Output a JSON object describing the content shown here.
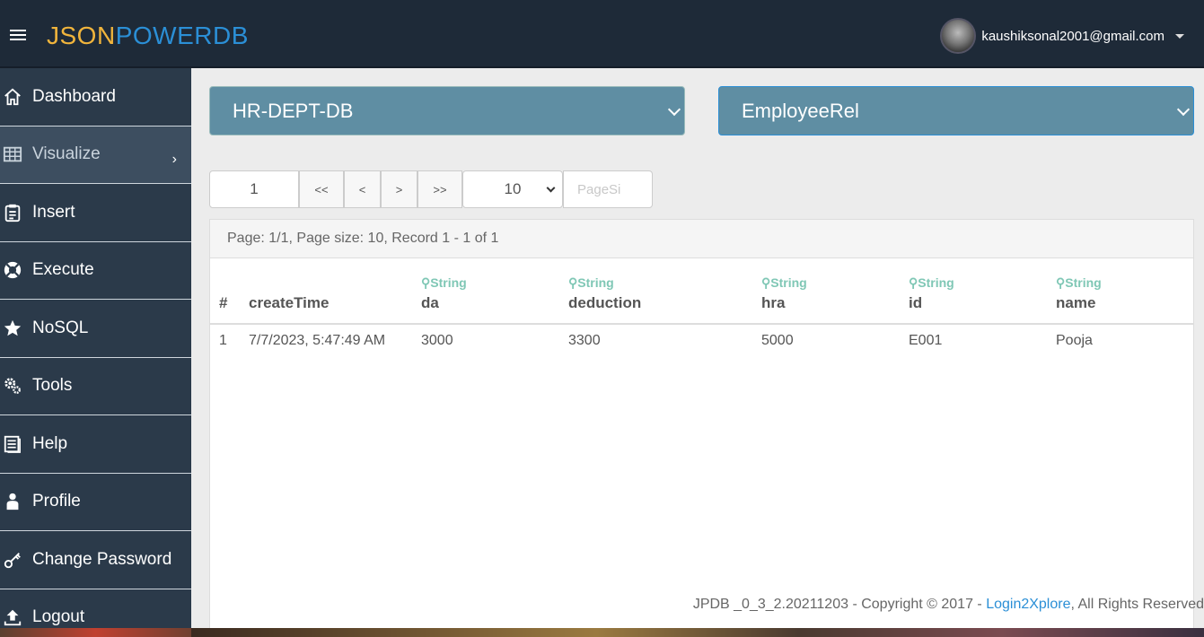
{
  "header": {
    "logo_part1": "JSON",
    "logo_part2": "POWERDB",
    "user_email": "kaushiksonal2001@gmail.com"
  },
  "sidebar": {
    "items": [
      {
        "label": "Dashboard",
        "icon": "home-icon"
      },
      {
        "label": "Visualize",
        "icon": "table-icon",
        "active": true
      },
      {
        "label": "Insert",
        "icon": "clipboard-icon"
      },
      {
        "label": "Execute",
        "icon": "life-ring-icon"
      },
      {
        "label": "NoSQL",
        "icon": "star-icon"
      },
      {
        "label": "Tools",
        "icon": "cogs-icon"
      },
      {
        "label": "Help",
        "icon": "book-icon"
      },
      {
        "label": "Profile",
        "icon": "user-icon"
      },
      {
        "label": "Change Password",
        "icon": "key-icon"
      },
      {
        "label": "Logout",
        "icon": "upload-icon"
      }
    ]
  },
  "selectors": {
    "database": "HR-DEPT-DB",
    "relation": "EmployeeRel"
  },
  "pager": {
    "page_value": "1",
    "first": "<<",
    "prev": "<",
    "next": ">",
    "last": ">>",
    "page_size": "10",
    "page_size_placeholder": "PageSi"
  },
  "panel": {
    "summary": "Page: 1/1, Page size: 10, Record 1 - 1 of 1"
  },
  "table": {
    "columns": [
      {
        "name": "#",
        "type": ""
      },
      {
        "name": "createTime",
        "type": ""
      },
      {
        "name": "da",
        "type": "String"
      },
      {
        "name": "deduction",
        "type": "String"
      },
      {
        "name": "hra",
        "type": "String"
      },
      {
        "name": "id",
        "type": "String"
      },
      {
        "name": "name",
        "type": "String"
      }
    ],
    "rows": [
      [
        "1",
        "7/7/2023, 5:47:49 AM",
        "3000",
        "3300",
        "5000",
        "E001",
        "Pooja"
      ]
    ]
  },
  "footer": {
    "text": "JPDB _0_3_2.20211203 - Copyright © 2017 - ",
    "link": "Login2Xplore",
    "suffix": ", All Rights Reserved"
  },
  "colors": {
    "topbar": "#1e2a38",
    "sidebar": "#2b3a4a",
    "select_bg": "#5f8ea3",
    "accent": "#2b8fd6",
    "logo_orange": "#f0b43c",
    "type_green": "#7fc7b5"
  }
}
